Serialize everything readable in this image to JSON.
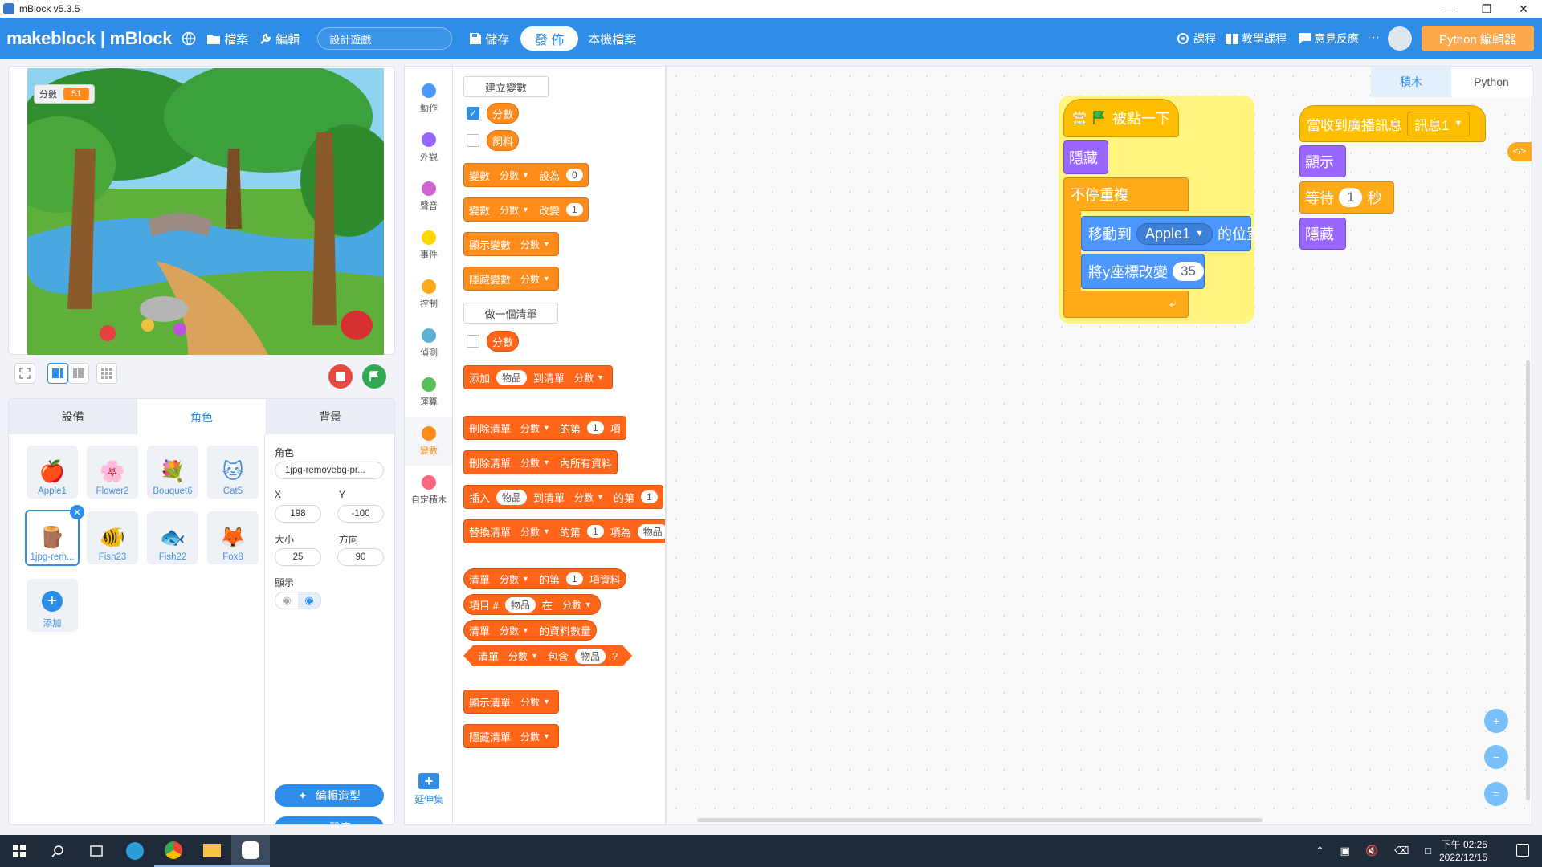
{
  "window": {
    "title": "mBlock v5.3.5"
  },
  "menubar": {
    "logo": "makeblock | mBlock",
    "file": "檔案",
    "edit": "編輯",
    "project_name": "設計遊戲",
    "save": "儲存",
    "publish": "發 佈",
    "local_file": "本機檔案",
    "courses": "課程",
    "tutorials": "教學課程",
    "feedback": "意見反應",
    "more": "···",
    "python_editor": "Python 編輯器"
  },
  "stage": {
    "variable_label": "分數",
    "variable_value": "51"
  },
  "sprite_panel": {
    "tabs": [
      "設備",
      "角色",
      "背景"
    ],
    "sprites": [
      {
        "name": "Apple1",
        "icon": "apple-icon",
        "glyph": "🍎"
      },
      {
        "name": "Flower2",
        "icon": "flower-icon",
        "glyph": "🌸"
      },
      {
        "name": "Bouquet6",
        "icon": "bouquet-icon",
        "glyph": "💐"
      },
      {
        "name": "Cat5",
        "icon": "cat-icon",
        "glyph": "🐱"
      },
      {
        "name": "1jpg-rem...",
        "icon": "image-sprite-icon",
        "glyph": "🪵"
      },
      {
        "name": "Fish23",
        "icon": "fish-icon",
        "glyph": "🐠"
      },
      {
        "name": "Fish22",
        "icon": "fish-icon",
        "glyph": "🐟"
      },
      {
        "name": "Fox8",
        "icon": "fox-icon",
        "glyph": "🦊"
      }
    ],
    "add_label": "添加",
    "props": {
      "sprite_label": "角色",
      "sprite_name": "1jpg-removebg-pr...",
      "x_label": "X",
      "x": "198",
      "y_label": "Y",
      "y": "-100",
      "size_label": "大小",
      "size": "25",
      "direction_label": "方向",
      "direction": "90",
      "show_label": "顯示",
      "edit_costume": "編輯造型",
      "sound": "聲音"
    }
  },
  "categories": [
    {
      "label": "動作",
      "color": "#4c97ff"
    },
    {
      "label": "外觀",
      "color": "#9966ff"
    },
    {
      "label": "聲音",
      "color": "#cf63cf"
    },
    {
      "label": "事件",
      "color": "#ffd500"
    },
    {
      "label": "控制",
      "color": "#ffab19"
    },
    {
      "label": "偵測",
      "color": "#5cb1d6"
    },
    {
      "label": "運算",
      "color": "#59c059"
    },
    {
      "label": "變數",
      "color": "#ff8c1a"
    },
    {
      "label": "自定積木",
      "color": "#ff6680"
    }
  ],
  "extension_label": "延伸集",
  "palette": {
    "make_variable": "建立變數",
    "var_score": "分數",
    "var_feed": "飼料",
    "set_var": {
      "a": "變數",
      "var": "分數",
      "b": "設為",
      "val": "0"
    },
    "change_var": {
      "a": "變數",
      "var": "分數",
      "b": "改變",
      "val": "1"
    },
    "show_var": {
      "a": "顯示變數",
      "var": "分數"
    },
    "hide_var": {
      "a": "隱藏變數",
      "var": "分數"
    },
    "make_list": "做一個清單",
    "list_score": "分數",
    "add_to_list": {
      "a": "添加",
      "item": "物品",
      "b": "到清單",
      "list": "分數"
    },
    "delete_item": {
      "a": "刪除清單",
      "list": "分數",
      "b": "的第",
      "n": "1",
      "c": "項"
    },
    "delete_all": {
      "a": "刪除清單",
      "list": "分數",
      "b": "內所有資料"
    },
    "insert_item": {
      "a": "插入",
      "item": "物品",
      "b": "到清單",
      "list": "分數",
      "c": "的第",
      "n": "1"
    },
    "replace_item": {
      "a": "替換清單",
      "list": "分數",
      "b": "的第",
      "n": "1",
      "c": "項為",
      "item": "物品"
    },
    "item_of": {
      "a": "清單",
      "list": "分數",
      "b": "的第",
      "n": "1",
      "c": "項資料"
    },
    "index_of": {
      "a": "項目 #",
      "item": "物品",
      "b": "在",
      "list": "分數"
    },
    "length_of": {
      "a": "清單",
      "list": "分數",
      "b": "的資料數量"
    },
    "contains": {
      "a": "清單",
      "list": "分數",
      "b": "包含",
      "item": "物品",
      "c": "?"
    },
    "show_list": {
      "a": "顯示清單",
      "list": "分數"
    },
    "hide_list": {
      "a": "隱藏清單",
      "list": "分數"
    }
  },
  "workspace": {
    "view_tabs": [
      "積木",
      "Python"
    ],
    "script1": {
      "when_flag_a": "當",
      "when_flag_b": "被點一下",
      "hide": "隱藏",
      "forever": "不停重複",
      "goto_a": "移動到",
      "goto_target": "Apple1",
      "goto_b": "的位置",
      "change_y": "將y座標改變",
      "change_y_val": "35"
    },
    "script2": {
      "when_receive": "當收到廣播訊息",
      "message": "訊息1",
      "show": "顯示",
      "wait_a": "等待",
      "wait_val": "1",
      "wait_b": "秒",
      "hide": "隱藏"
    }
  },
  "taskbar": {
    "time_period": "下午 02:25",
    "date": "2022/12/15"
  }
}
